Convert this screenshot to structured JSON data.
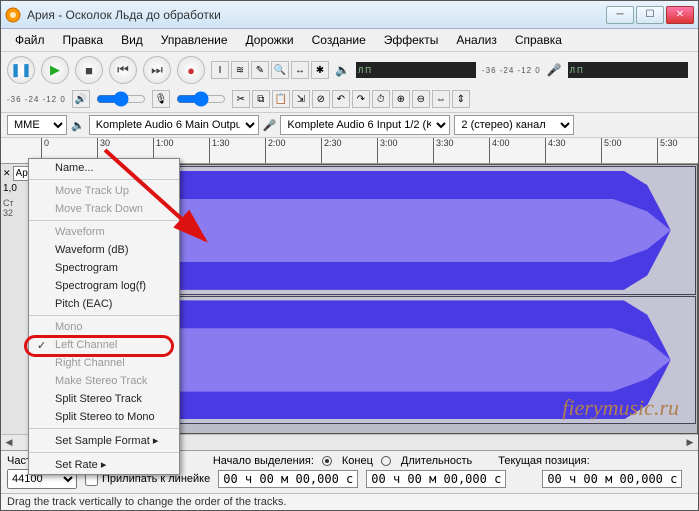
{
  "window": {
    "title": "Ария - Осколок Льда до обработки"
  },
  "menu": {
    "items": [
      "Файл",
      "Правка",
      "Вид",
      "Управление",
      "Дорожки",
      "Создание",
      "Эффекты",
      "Анализ",
      "Справка"
    ]
  },
  "db_scale": "-36  -24  -12  0",
  "db_scale2": "-36  -24  -12  0",
  "devices": {
    "host": "MME",
    "output": "Komplete Audio 6 Main Output",
    "input": "Komplete Audio 6 Input 1/2 (K",
    "channels": "2 (стерео) канал"
  },
  "ruler": [
    "0",
    "30",
    "1:00",
    "1:30",
    "2:00",
    "2:30",
    "3:00",
    "3:30",
    "4:00",
    "4:30",
    "5:00",
    "5:30"
  ],
  "track": {
    "name": "Ария - Оск",
    "gain": "1,0",
    "side": "32"
  },
  "ctx": {
    "items": [
      {
        "label": "Name...",
        "enabled": true
      },
      {
        "sep": true
      },
      {
        "label": "Move Track Up",
        "enabled": false
      },
      {
        "label": "Move Track Down",
        "enabled": false
      },
      {
        "sep": true
      },
      {
        "label": "Waveform",
        "enabled": false
      },
      {
        "label": "Waveform (dB)",
        "enabled": true
      },
      {
        "label": "Spectrogram",
        "enabled": true
      },
      {
        "label": "Spectrogram log(f)",
        "enabled": true
      },
      {
        "label": "Pitch (EAC)",
        "enabled": true
      },
      {
        "sep": true
      },
      {
        "label": "Mono",
        "enabled": false
      },
      {
        "label": "Left Channel",
        "enabled": false,
        "checked": true
      },
      {
        "label": "Right Channel",
        "enabled": false
      },
      {
        "label": "Make Stereo Track",
        "enabled": false
      },
      {
        "label": "Split Stereo Track",
        "enabled": true
      },
      {
        "label": "Split Stereo to Mono",
        "enabled": true
      },
      {
        "sep": true
      },
      {
        "label": "Set Sample Format",
        "enabled": true,
        "arrow": true
      },
      {
        "sep": true
      },
      {
        "label": "Set Rate",
        "enabled": true,
        "arrow": true
      }
    ]
  },
  "bottom": {
    "rate_label": "Частота проекта (Гц):",
    "rate_value": "44100",
    "snap_label": "Прилипать к линейке",
    "sel_start_label": "Начало выделения:",
    "end_label": "Конец",
    "dur_label": "Длительность",
    "pos_label": "Текущая позиция:",
    "time_zero": "00 ч 00 м 00,000 с"
  },
  "status": "Drag the track vertically to change the order of the tracks.",
  "watermark": "fierymusic.ru"
}
